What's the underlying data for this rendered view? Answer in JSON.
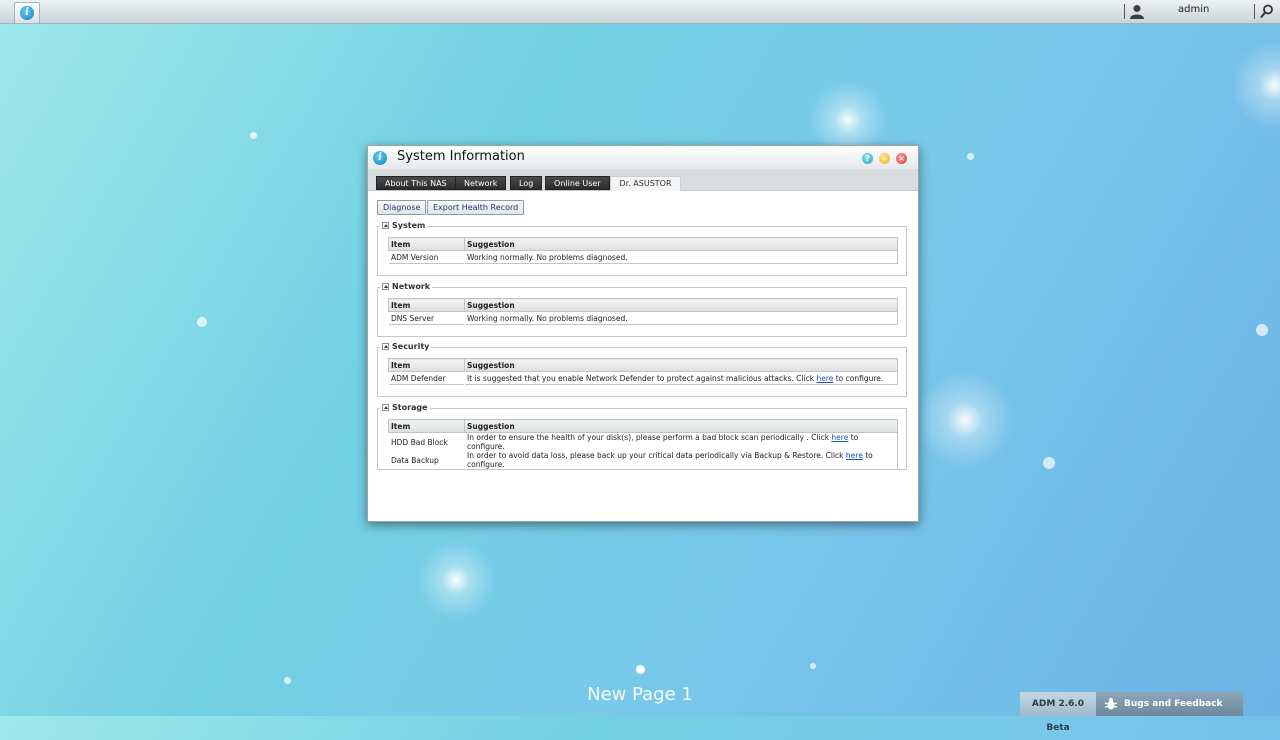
{
  "topbar": {
    "username": "admin"
  },
  "window": {
    "title": "System Information",
    "tabs": [
      {
        "label": "About This NAS"
      },
      {
        "label": "Network"
      },
      {
        "label": "Log"
      },
      {
        "label": "Online User"
      },
      {
        "label": "Dr. ASUSTOR",
        "active": true
      }
    ],
    "actions": {
      "diagnose": "Diagnose",
      "export": "Export Health Record"
    },
    "columns": {
      "item": "Item",
      "suggestion": "Suggestion"
    },
    "sections": {
      "system": {
        "title": "System",
        "rows": [
          {
            "item": "ADM Version",
            "suggestion": "Working normally. No problems diagnosed."
          }
        ]
      },
      "network": {
        "title": "Network",
        "rows": [
          {
            "item": "DNS Server",
            "suggestion": "Working normally. No problems diagnosed."
          }
        ]
      },
      "security": {
        "title": "Security",
        "rows": [
          {
            "item": "ADM Defender",
            "suggestion_pre": "It is suggested that you enable Network Defender to protect against malicious attacks. Click ",
            "link": "here",
            "suggestion_post": " to configure."
          }
        ]
      },
      "storage": {
        "title": "Storage",
        "rows": [
          {
            "item": "HDD Bad Block",
            "suggestion_pre": "In order to ensure the health of your disk(s), please perform a bad block scan periodically . Click ",
            "link": "here",
            "suggestion_post": " to configure."
          },
          {
            "item": "Data Backup",
            "suggestion_pre": "In order to avoid data loss, please back up your critical data periodically via Backup & Restore. Click ",
            "link": "here",
            "suggestion_post": " to configure."
          }
        ]
      }
    }
  },
  "desktop": {
    "page_name": "New Page 1"
  },
  "footer": {
    "version": "ADM 2.6.0 Beta",
    "feedback": "Bugs and Feedback"
  }
}
